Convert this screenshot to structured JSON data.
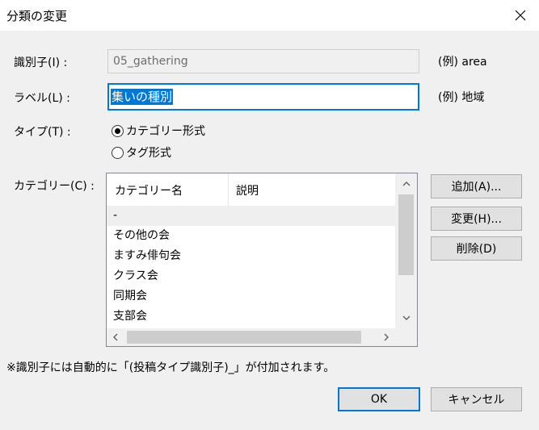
{
  "dialog": {
    "title": "分類の変更"
  },
  "fields": {
    "identifier": {
      "label": "識別子(I) :",
      "value": "05_gathering",
      "example": "(例) area"
    },
    "label": {
      "label": "ラベル(L) :",
      "value": "集いの種別",
      "example": "(例) 地域"
    },
    "type": {
      "label": "タイプ(T) :",
      "options": [
        {
          "label": "カテゴリー形式",
          "selected": true
        },
        {
          "label": "タグ形式",
          "selected": false
        }
      ]
    }
  },
  "categories": {
    "label": "カテゴリー(C) :",
    "columns": [
      "カテゴリー名",
      "説明"
    ],
    "rows": [
      "-",
      "その他の会",
      "ますみ俳句会",
      "クラス会",
      "同期会",
      "支部会"
    ],
    "selected_index": 0
  },
  "side_buttons": {
    "add": "追加(A)...",
    "edit": "変更(H)...",
    "delete": "削除(D)"
  },
  "note": "※識別子には自動的に「(投稿タイプ識別子)_」が付加されます。",
  "footer": {
    "ok": "OK",
    "cancel": "キャンセル"
  },
  "colors": {
    "accent": "#0078d7",
    "window_bg": "#f0f0f0"
  },
  "icons": [
    "close-icon",
    "scroll-up-icon",
    "scroll-down-icon",
    "scroll-left-icon",
    "scroll-right-icon"
  ]
}
